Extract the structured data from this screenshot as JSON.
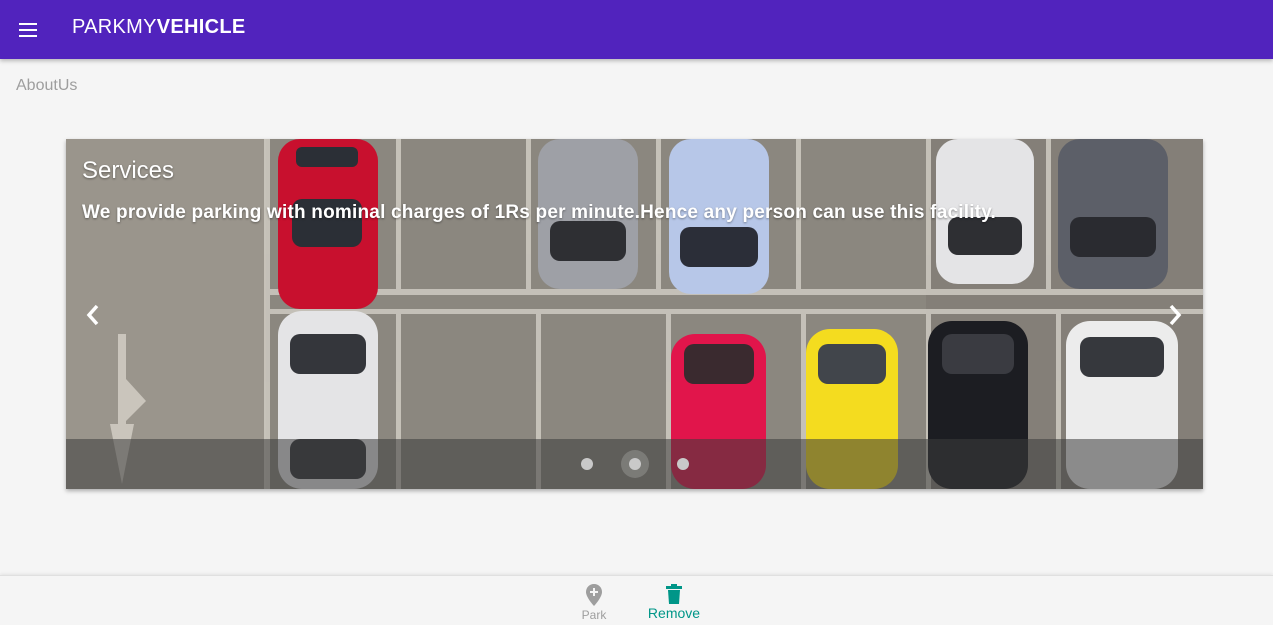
{
  "header": {
    "brand_light": "PARKMY",
    "brand_bold": "VEHICLE",
    "menu_icon": "menu-icon",
    "bar_color": "#5123bd"
  },
  "breadcrumb": "AboutUs",
  "carousel": {
    "title": "Services",
    "text": "We provide parking with nominal charges of 1Rs per minute.Hence any person can use this facility.",
    "slide_count": 3,
    "active_index": 1,
    "prev_icon": "chevron-left-icon",
    "next_icon": "chevron-right-icon"
  },
  "bottom_nav": {
    "items": [
      {
        "label": "Park",
        "icon": "map-pin-plus-icon",
        "active": false
      },
      {
        "label": "Remove",
        "icon": "trash-icon",
        "active": true
      }
    ],
    "active_color": "#009688"
  }
}
